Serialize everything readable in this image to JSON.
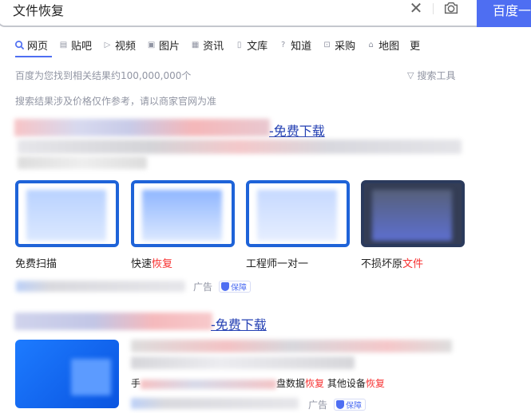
{
  "search": {
    "query": "文件恢复",
    "button_label": "百度一下"
  },
  "tabs": [
    {
      "label": "网页",
      "icon": "search-icon"
    },
    {
      "label": "贴吧",
      "icon": "tieba-icon"
    },
    {
      "label": "视频",
      "icon": "video-icon"
    },
    {
      "label": "图片",
      "icon": "image-icon"
    },
    {
      "label": "资讯",
      "icon": "news-icon"
    },
    {
      "label": "文库",
      "icon": "document-icon"
    },
    {
      "label": "知道",
      "icon": "question-icon"
    },
    {
      "label": "采购",
      "icon": "shopping-icon"
    },
    {
      "label": "地图",
      "icon": "map-icon"
    },
    {
      "label": "更",
      "icon": ""
    }
  ],
  "results_meta": "百度为您找到相关结果约100,000,000个",
  "search_tools": "搜索工具",
  "price_notice": "搜索结果涉及价格仅作参考，请以商家官网为准",
  "result1": {
    "title_tail": "-免费下载",
    "cards": [
      {
        "label_plain": "免费扫描",
        "label_hl": ""
      },
      {
        "label_plain": "快速",
        "label_hl": "恢复"
      },
      {
        "label_plain": "工程师一对一",
        "label_hl": ""
      },
      {
        "label_plain": "不损坏原",
        "label_hl": "文件"
      }
    ],
    "ad_label": "广告",
    "badge": "保障"
  },
  "result2": {
    "title_tail": "-免费下载",
    "links_a": "手",
    "links_b": "盘数据",
    "links_c": "恢复",
    "links_d": "其他设备",
    "links_e": "恢复",
    "ad_label": "广告",
    "badge": "保障"
  },
  "colors": {
    "accent": "#4e6ef2",
    "link": "#2440b3",
    "highlight": "#f73131",
    "meta": "#9195a3"
  }
}
